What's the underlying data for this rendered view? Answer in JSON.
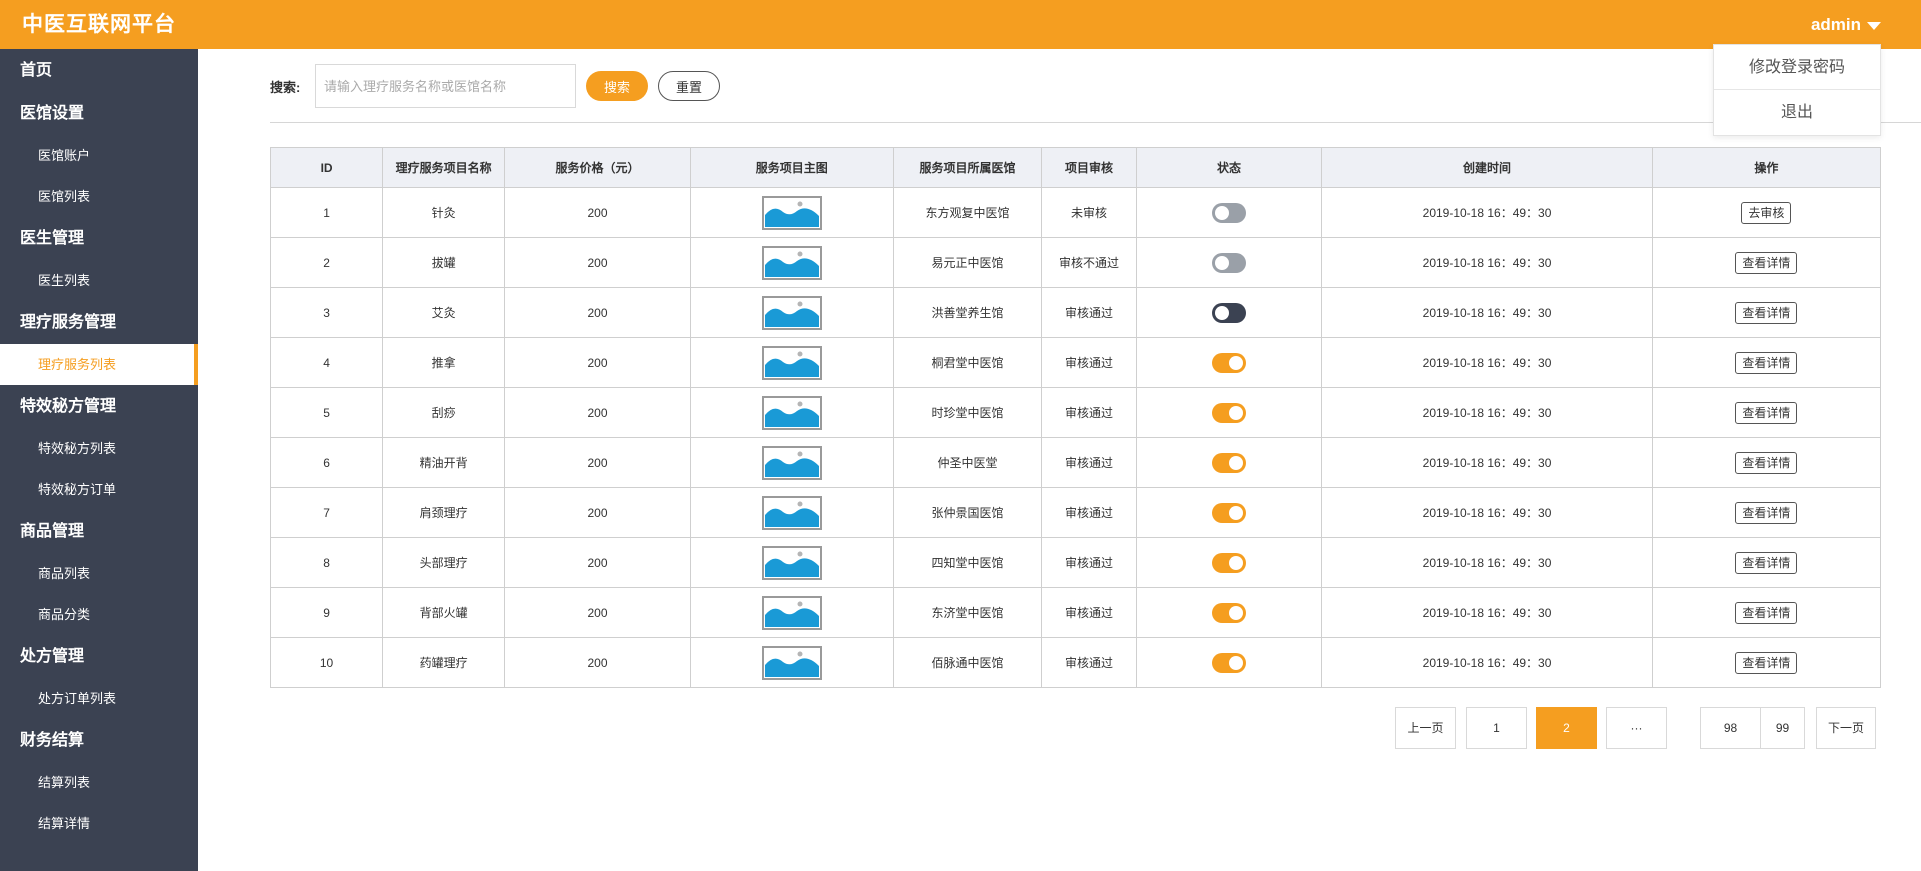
{
  "app": {
    "title": "中医互联网平台"
  },
  "header": {
    "user": "admin"
  },
  "user_menu": [
    {
      "label": "修改登录密码"
    },
    {
      "label": "退出"
    }
  ],
  "sidebar": [
    {
      "label": "首页",
      "children": []
    },
    {
      "label": "医馆设置",
      "children": [
        {
          "label": "医馆账户"
        },
        {
          "label": "医馆列表"
        }
      ]
    },
    {
      "label": "医生管理",
      "children": [
        {
          "label": "医生列表"
        }
      ]
    },
    {
      "label": "理疗服务管理",
      "children": [
        {
          "label": "理疗服务列表",
          "active": true
        }
      ]
    },
    {
      "label": "特效秘方管理",
      "children": [
        {
          "label": "特效秘方列表"
        },
        {
          "label": "特效秘方订单"
        }
      ]
    },
    {
      "label": "商品管理",
      "children": [
        {
          "label": "商品列表"
        },
        {
          "label": "商品分类"
        }
      ]
    },
    {
      "label": "处方管理",
      "children": [
        {
          "label": "处方订单列表"
        }
      ]
    },
    {
      "label": "财务结算",
      "children": [
        {
          "label": "结算列表"
        },
        {
          "label": "结算详情"
        }
      ]
    }
  ],
  "search": {
    "label": "搜索:",
    "placeholder": "请输入理疗服务名称或医馆名称",
    "search_button": "搜索",
    "reset_button": "重置"
  },
  "table": {
    "columns": [
      "ID",
      "理疗服务项目名称",
      "服务价格（元）",
      "服务项目主图",
      "服务项目所属医馆",
      "项目审核",
      "状态",
      "创建时间",
      "操作"
    ],
    "rows": [
      {
        "id": "1",
        "name": "针灸",
        "price": "200",
        "clinic": "东方观复中医馆",
        "review": "未审核",
        "review_state": "pending",
        "toggle": "off",
        "created": "2019-10-18  16：49：30",
        "action": "去审核"
      },
      {
        "id": "2",
        "name": "拔罐",
        "price": "200",
        "clinic": "易元正中医馆",
        "review": "审核不通过",
        "review_state": "reject",
        "toggle": "off",
        "created": "2019-10-18  16：49：30",
        "action": "查看详情"
      },
      {
        "id": "3",
        "name": "艾灸",
        "price": "200",
        "clinic": "洪善堂养生馆",
        "review": "审核通过",
        "review_state": "pass",
        "toggle": "dark",
        "created": "2019-10-18  16：49：30",
        "action": "查看详情"
      },
      {
        "id": "4",
        "name": "推拿",
        "price": "200",
        "clinic": "桐君堂中医馆",
        "review": "审核通过",
        "review_state": "pass",
        "toggle": "on",
        "created": "2019-10-18  16：49：30",
        "action": "查看详情"
      },
      {
        "id": "5",
        "name": "刮痧",
        "price": "200",
        "clinic": "时珍堂中医馆",
        "review": "审核通过",
        "review_state": "pass",
        "toggle": "on",
        "created": "2019-10-18  16：49：30",
        "action": "查看详情"
      },
      {
        "id": "6",
        "name": "精油开背",
        "price": "200",
        "clinic": "仲圣中医堂",
        "review": "审核通过",
        "review_state": "pass",
        "toggle": "on",
        "created": "2019-10-18  16：49：30",
        "action": "查看详情"
      },
      {
        "id": "7",
        "name": "肩颈理疗",
        "price": "200",
        "clinic": "张仲景国医馆",
        "review": "审核通过",
        "review_state": "pass",
        "toggle": "on",
        "created": "2019-10-18  16：49：30",
        "action": "查看详情"
      },
      {
        "id": "8",
        "name": "头部理疗",
        "price": "200",
        "clinic": "四知堂中医馆",
        "review": "审核通过",
        "review_state": "pass",
        "toggle": "on",
        "created": "2019-10-18  16：49：30",
        "action": "查看详情"
      },
      {
        "id": "9",
        "name": "背部火罐",
        "price": "200",
        "clinic": "东济堂中医馆",
        "review": "审核通过",
        "review_state": "pass",
        "toggle": "on",
        "created": "2019-10-18  16：49：30",
        "action": "查看详情"
      },
      {
        "id": "10",
        "name": "药罐理疗",
        "price": "200",
        "clinic": "佰脉通中医馆",
        "review": "审核通过",
        "review_state": "pass",
        "toggle": "on",
        "created": "2019-10-18  16：49：30",
        "action": "查看详情"
      }
    ]
  },
  "pagination": {
    "prev": "上一页",
    "next": "下一页",
    "pages": [
      "1",
      "2",
      "···",
      "98",
      "99"
    ],
    "current": "2"
  },
  "colors": {
    "accent": "#f59e20",
    "sidebar_bg": "#3b4252",
    "pass": "#3f9a1e",
    "reject": "#e0001b",
    "pending": "#e8901a",
    "image_fill": "#1a9ad6"
  }
}
